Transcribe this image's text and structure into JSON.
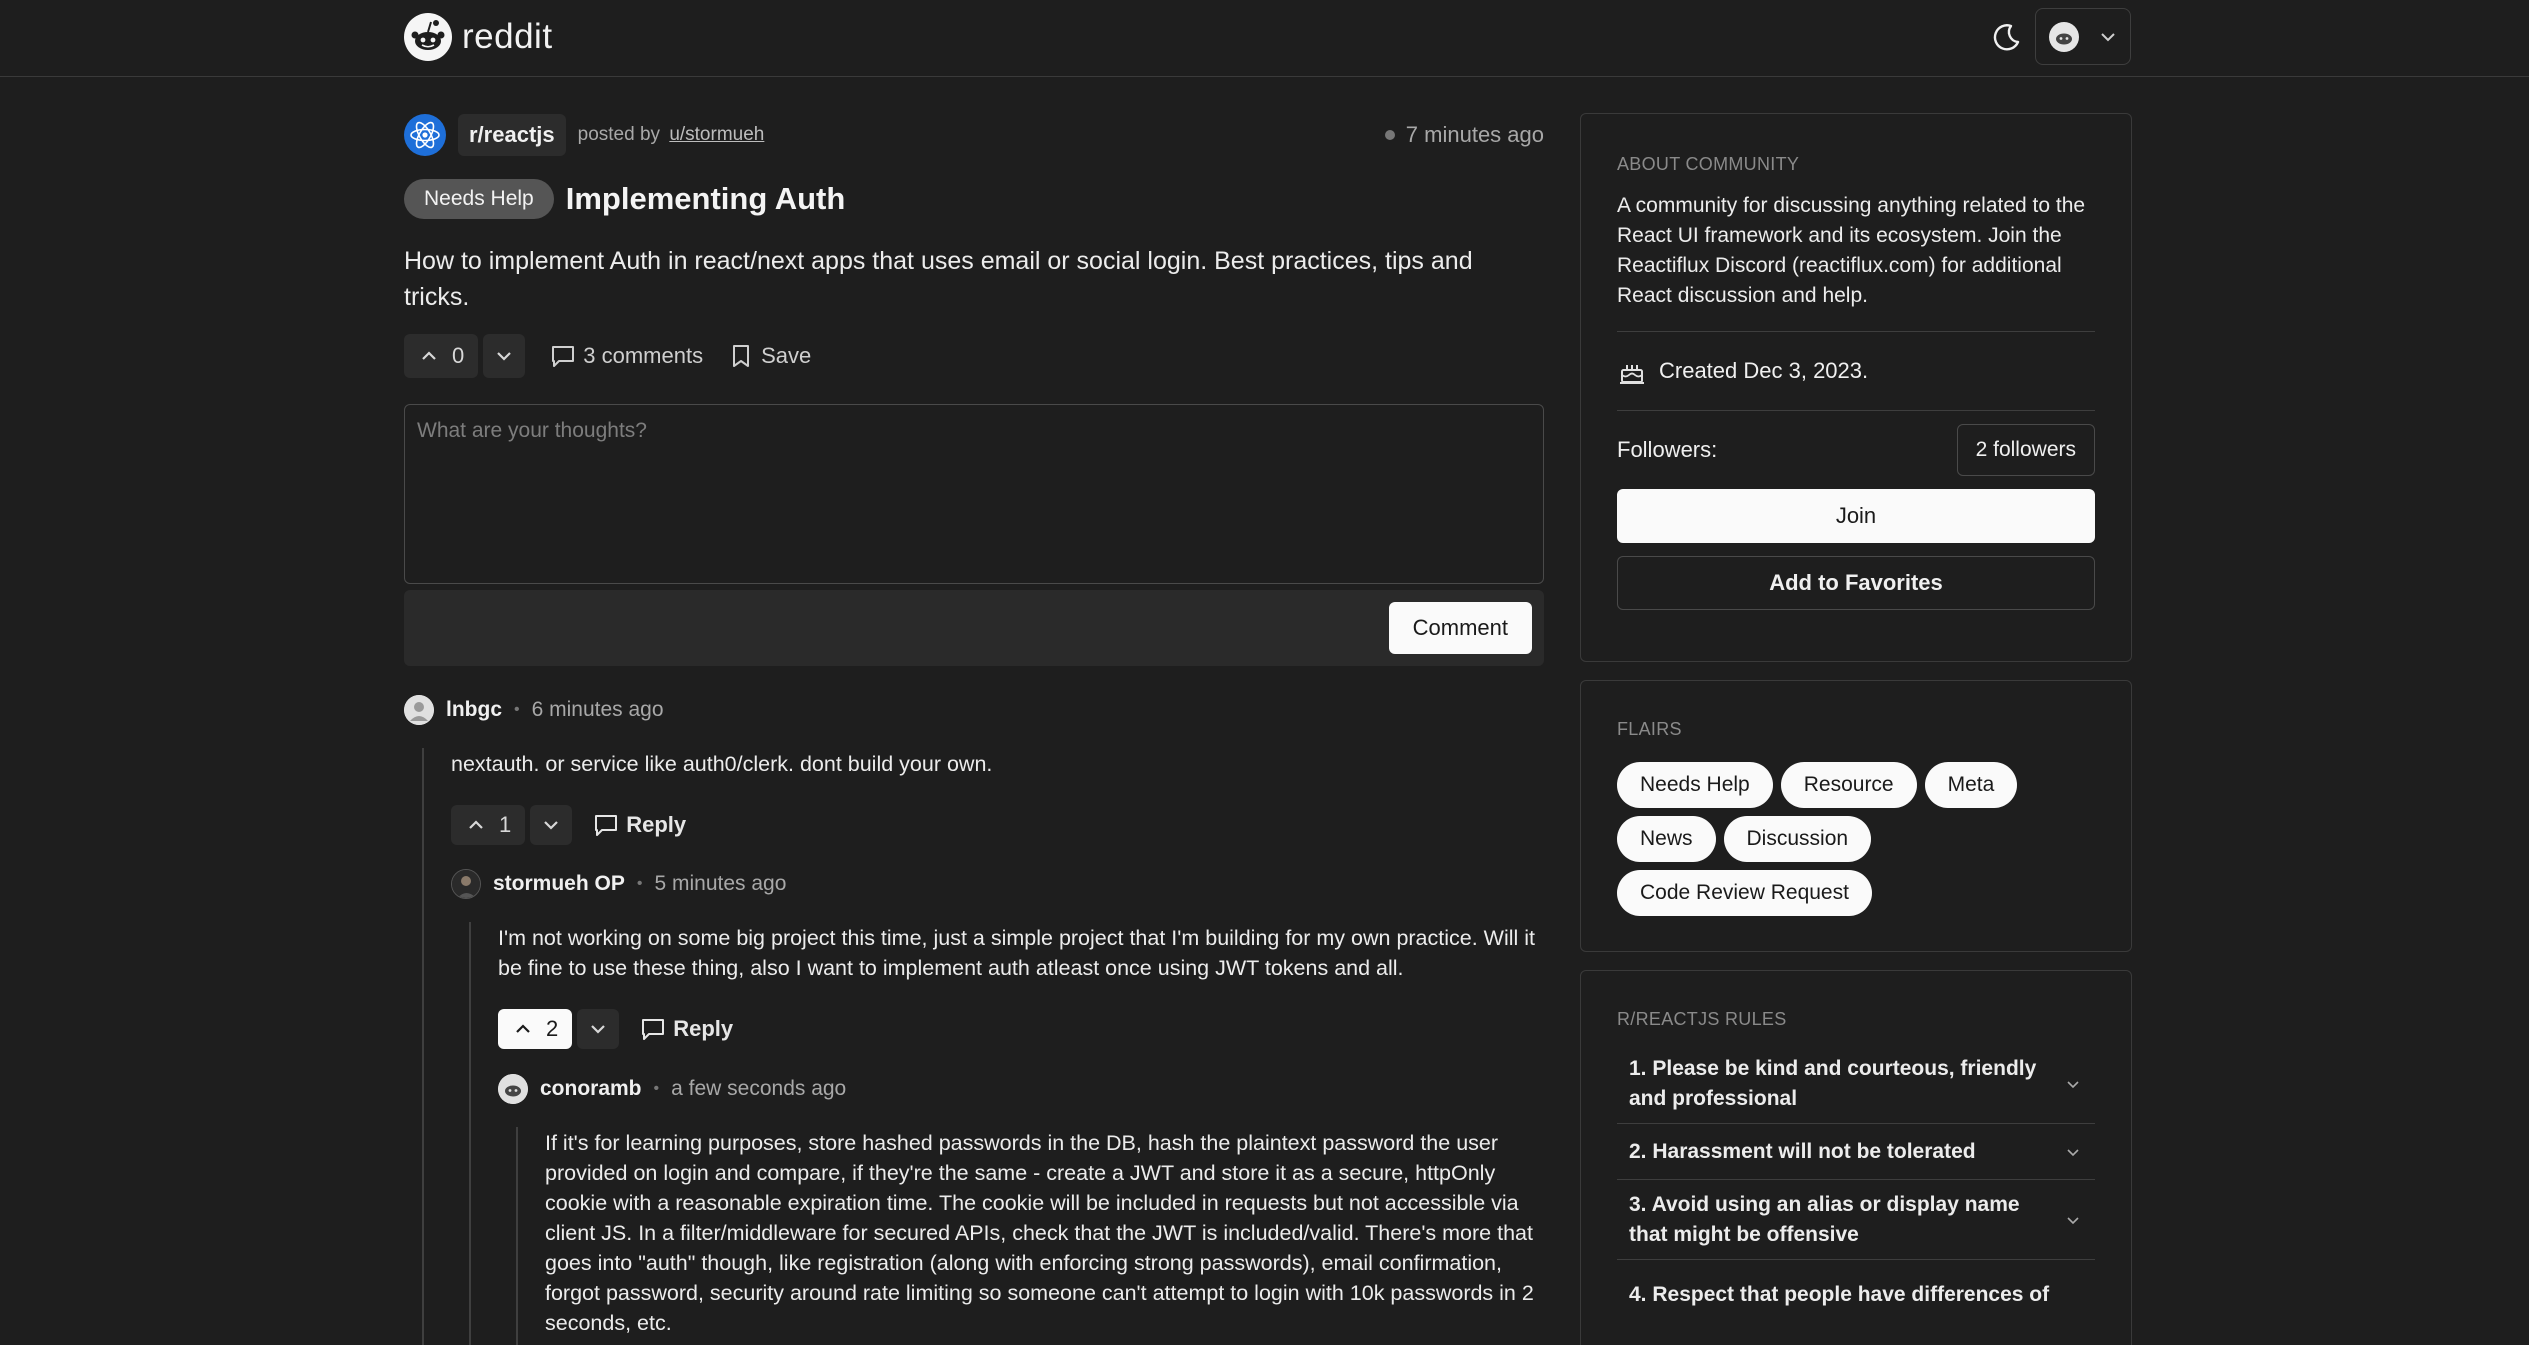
{
  "header": {
    "logo_text": "reddit",
    "theme_icon": "moon-icon",
    "user_icon": "reddit-avatar-icon"
  },
  "post": {
    "subreddit": "r/reactjs",
    "posted_by_prefix": "posted by",
    "author": "u/stormueh",
    "time": "7 minutes ago",
    "flair": "Needs Help",
    "title": "Implementing Auth",
    "body": "How to implement Auth in react/next apps that uses email or social login. Best practices, tips and tricks.",
    "upvotes": "0",
    "comments_label": "3 comments",
    "save_label": "Save"
  },
  "comment_form": {
    "placeholder": "What are your thoughts?",
    "submit_label": "Comment"
  },
  "comments": [
    {
      "author": "lnbgc",
      "sep": "•",
      "time": "6 minutes ago",
      "body": "nextauth. or service like auth0/clerk. dont build your own.",
      "votes": "1",
      "reply_label": "Reply"
    },
    {
      "author": "stormueh OP",
      "sep": "•",
      "time": "5 minutes ago",
      "body": "I'm not working on some big project this time, just a simple project that I'm building for my own practice. Will it be fine to use these thing, also I want to implement auth atleast once using JWT tokens and all.",
      "votes": "2",
      "reply_label": "Reply"
    },
    {
      "author": "conoramb",
      "sep": "•",
      "time": "a few seconds ago",
      "body": "If it's for learning purposes, store hashed passwords in the DB, hash the plaintext password the user provided on login and compare, if they're the same - create a JWT and store it as a secure, httpOnly cookie with a reasonable expiration time. The cookie will be included in requests but not accessible via client JS. In a filter/middleware for secured APIs, check that the JWT is included/valid. There's more that goes into \"auth\" though, like registration (along with enforcing strong passwords), email confirmation, forgot password, security around rate limiting so someone can't attempt to login with 10k passwords in 2 seconds, etc."
    }
  ],
  "sidebar": {
    "about": {
      "label": "ABOUT COMMUNITY",
      "text": "A community for discussing anything related to the React UI framework and its ecosystem. Join the Reactiflux Discord (reactiflux.com) for additional React discussion and help.",
      "created": "Created Dec 3, 2023.",
      "followers_label": "Followers:",
      "followers_count": "2 followers",
      "join_label": "Join",
      "favorites_label": "Add to Favorites"
    },
    "flairs": {
      "label": "FLAIRS",
      "items": [
        "Needs Help",
        "Resource",
        "Meta",
        "News",
        "Discussion",
        "Code Review Request"
      ]
    },
    "rules": {
      "label": "R/REACTJS RULES",
      "items": [
        "1. Please be kind and courteous, friendly and professional",
        "2. Harassment will not be tolerated",
        "3. Avoid using an alias or display name that might be offensive",
        "4. Respect that people have differences of"
      ]
    }
  }
}
